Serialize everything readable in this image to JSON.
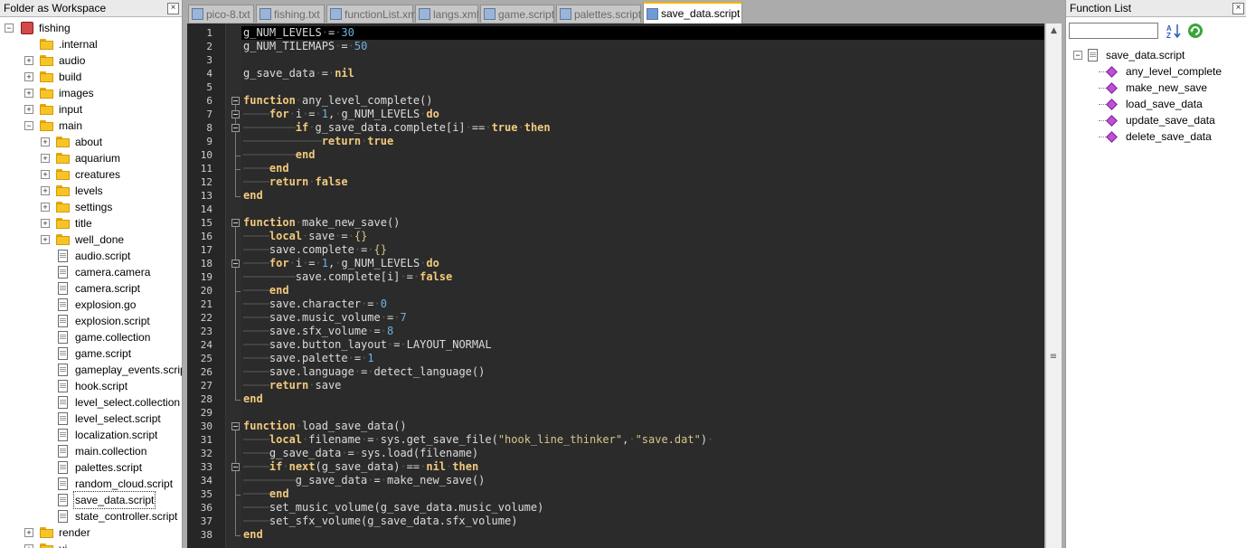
{
  "workspace": {
    "title": "Folder as Workspace",
    "close": "×",
    "tree": [
      {
        "label": "fishing",
        "depth": 0,
        "type": "root",
        "exp": "−"
      },
      {
        "label": ".internal",
        "depth": 1,
        "type": "folder",
        "exp": ""
      },
      {
        "label": "audio",
        "depth": 1,
        "type": "folder",
        "exp": "+"
      },
      {
        "label": "build",
        "depth": 1,
        "type": "folder",
        "exp": "+"
      },
      {
        "label": "images",
        "depth": 1,
        "type": "folder",
        "exp": "+"
      },
      {
        "label": "input",
        "depth": 1,
        "type": "folder",
        "exp": "+"
      },
      {
        "label": "main",
        "depth": 1,
        "type": "folder",
        "exp": "−"
      },
      {
        "label": "about",
        "depth": 2,
        "type": "folder",
        "exp": "+"
      },
      {
        "label": "aquarium",
        "depth": 2,
        "type": "folder",
        "exp": "+"
      },
      {
        "label": "creatures",
        "depth": 2,
        "type": "folder",
        "exp": "+"
      },
      {
        "label": "levels",
        "depth": 2,
        "type": "folder",
        "exp": "+"
      },
      {
        "label": "settings",
        "depth": 2,
        "type": "folder",
        "exp": "+"
      },
      {
        "label": "title",
        "depth": 2,
        "type": "folder",
        "exp": "+"
      },
      {
        "label": "well_done",
        "depth": 2,
        "type": "folder",
        "exp": "+"
      },
      {
        "label": "audio.script",
        "depth": 2,
        "type": "file",
        "exp": ""
      },
      {
        "label": "camera.camera",
        "depth": 2,
        "type": "file",
        "exp": ""
      },
      {
        "label": "camera.script",
        "depth": 2,
        "type": "file",
        "exp": ""
      },
      {
        "label": "explosion.go",
        "depth": 2,
        "type": "file",
        "exp": ""
      },
      {
        "label": "explosion.script",
        "depth": 2,
        "type": "file",
        "exp": ""
      },
      {
        "label": "game.collection",
        "depth": 2,
        "type": "file",
        "exp": ""
      },
      {
        "label": "game.script",
        "depth": 2,
        "type": "file",
        "exp": ""
      },
      {
        "label": "gameplay_events.script",
        "depth": 2,
        "type": "file",
        "exp": ""
      },
      {
        "label": "hook.script",
        "depth": 2,
        "type": "file",
        "exp": ""
      },
      {
        "label": "level_select.collection",
        "depth": 2,
        "type": "file",
        "exp": ""
      },
      {
        "label": "level_select.script",
        "depth": 2,
        "type": "file",
        "exp": ""
      },
      {
        "label": "localization.script",
        "depth": 2,
        "type": "file",
        "exp": ""
      },
      {
        "label": "main.collection",
        "depth": 2,
        "type": "file",
        "exp": ""
      },
      {
        "label": "palettes.script",
        "depth": 2,
        "type": "file",
        "exp": ""
      },
      {
        "label": "random_cloud.script",
        "depth": 2,
        "type": "file",
        "exp": ""
      },
      {
        "label": "save_data.script",
        "depth": 2,
        "type": "file",
        "exp": "",
        "selected": true
      },
      {
        "label": "state_controller.script",
        "depth": 2,
        "type": "file",
        "exp": ""
      },
      {
        "label": "render",
        "depth": 1,
        "type": "folder",
        "exp": "+"
      },
      {
        "label": "ui",
        "depth": 1,
        "type": "folder",
        "exp": "+"
      }
    ]
  },
  "tabs": [
    {
      "label": "pico-8.txt",
      "active": false
    },
    {
      "label": "fishing.txt",
      "active": false
    },
    {
      "label": "functionList.xml",
      "active": false
    },
    {
      "label": "langs.xml",
      "active": false
    },
    {
      "label": "game.script",
      "active": false
    },
    {
      "label": "palettes.script",
      "active": false
    },
    {
      "label": "save_data.script",
      "active": true
    }
  ],
  "editor": {
    "lines": [
      {
        "n": "1",
        "t": [
          [
            "var",
            "g_NUM_LEVELS"
          ],
          [
            "ws",
            "·"
          ],
          [
            "op",
            "="
          ],
          [
            "ws",
            "·"
          ],
          [
            "num",
            "30"
          ]
        ]
      },
      {
        "n": "2",
        "t": [
          [
            "var",
            "g_NUM_TILEMAPS"
          ],
          [
            "ws",
            "·"
          ],
          [
            "op",
            "="
          ],
          [
            "ws",
            "·"
          ],
          [
            "num",
            "50"
          ]
        ]
      },
      {
        "n": "3",
        "t": []
      },
      {
        "n": "4",
        "t": [
          [
            "var",
            "g_save_data"
          ],
          [
            "ws",
            "·"
          ],
          [
            "op",
            "="
          ],
          [
            "ws",
            "·"
          ],
          [
            "kw",
            "nil"
          ]
        ]
      },
      {
        "n": "5",
        "t": []
      },
      {
        "n": "6",
        "t": [
          [
            "kw",
            "function"
          ],
          [
            "ws",
            "·"
          ],
          [
            "var",
            "any_level_complete()"
          ]
        ]
      },
      {
        "n": "7",
        "t": [
          [
            "ws",
            "────"
          ],
          [
            "kw",
            "for"
          ],
          [
            "ws",
            "·"
          ],
          [
            "var",
            "i"
          ],
          [
            "ws",
            "·"
          ],
          [
            "op",
            "="
          ],
          [
            "ws",
            "·"
          ],
          [
            "num",
            "1"
          ],
          [
            "op",
            ","
          ],
          [
            "ws",
            "·"
          ],
          [
            "var",
            "g_NUM_LEVELS"
          ],
          [
            "ws",
            "·"
          ],
          [
            "kw",
            "do"
          ]
        ]
      },
      {
        "n": "8",
        "t": [
          [
            "ws",
            "────────"
          ],
          [
            "kw",
            "if"
          ],
          [
            "ws",
            "·"
          ],
          [
            "var",
            "g_save_data.complete[i]"
          ],
          [
            "ws",
            "·"
          ],
          [
            "op",
            "=="
          ],
          [
            "ws",
            "·"
          ],
          [
            "kw",
            "true"
          ],
          [
            "ws",
            "·"
          ],
          [
            "kw",
            "then"
          ]
        ]
      },
      {
        "n": "9",
        "t": [
          [
            "ws",
            "────────────"
          ],
          [
            "kw",
            "return"
          ],
          [
            "ws",
            "·"
          ],
          [
            "kw",
            "true"
          ]
        ]
      },
      {
        "n": "10",
        "t": [
          [
            "ws",
            "────────"
          ],
          [
            "kw",
            "end"
          ]
        ]
      },
      {
        "n": "11",
        "t": [
          [
            "ws",
            "────"
          ],
          [
            "kw",
            "end"
          ]
        ]
      },
      {
        "n": "12",
        "t": [
          [
            "ws",
            "────"
          ],
          [
            "kw",
            "return"
          ],
          [
            "ws",
            "·"
          ],
          [
            "kw",
            "false"
          ]
        ]
      },
      {
        "n": "13",
        "t": [
          [
            "kw",
            "end"
          ]
        ]
      },
      {
        "n": "14",
        "t": []
      },
      {
        "n": "15",
        "t": [
          [
            "kw",
            "function"
          ],
          [
            "ws",
            "·"
          ],
          [
            "var",
            "make_new_save()"
          ]
        ]
      },
      {
        "n": "16",
        "t": [
          [
            "ws",
            "────"
          ],
          [
            "kw",
            "local"
          ],
          [
            "ws",
            "·"
          ],
          [
            "var",
            "save"
          ],
          [
            "ws",
            "·"
          ],
          [
            "op",
            "="
          ],
          [
            "ws",
            "·"
          ],
          [
            "str",
            "{}"
          ]
        ]
      },
      {
        "n": "17",
        "t": [
          [
            "ws",
            "────"
          ],
          [
            "var",
            "save.complete"
          ],
          [
            "ws",
            "·"
          ],
          [
            "op",
            "="
          ],
          [
            "ws",
            "·"
          ],
          [
            "str",
            "{}"
          ]
        ]
      },
      {
        "n": "18",
        "t": [
          [
            "ws",
            "────"
          ],
          [
            "kw",
            "for"
          ],
          [
            "ws",
            "·"
          ],
          [
            "var",
            "i"
          ],
          [
            "ws",
            "·"
          ],
          [
            "op",
            "="
          ],
          [
            "ws",
            "·"
          ],
          [
            "num",
            "1"
          ],
          [
            "op",
            ","
          ],
          [
            "ws",
            "·"
          ],
          [
            "var",
            "g_NUM_LEVELS"
          ],
          [
            "ws",
            "·"
          ],
          [
            "kw",
            "do"
          ]
        ]
      },
      {
        "n": "19",
        "t": [
          [
            "ws",
            "────────"
          ],
          [
            "var",
            "save.complete[i]"
          ],
          [
            "ws",
            "·"
          ],
          [
            "op",
            "="
          ],
          [
            "ws",
            "·"
          ],
          [
            "kw",
            "false"
          ]
        ]
      },
      {
        "n": "20",
        "t": [
          [
            "ws",
            "────"
          ],
          [
            "kw",
            "end"
          ]
        ]
      },
      {
        "n": "21",
        "t": [
          [
            "ws",
            "────"
          ],
          [
            "var",
            "save.character"
          ],
          [
            "ws",
            "·"
          ],
          [
            "op",
            "="
          ],
          [
            "ws",
            "·"
          ],
          [
            "num",
            "0"
          ]
        ]
      },
      {
        "n": "22",
        "t": [
          [
            "ws",
            "────"
          ],
          [
            "var",
            "save.music_volume"
          ],
          [
            "ws",
            "·"
          ],
          [
            "op",
            "="
          ],
          [
            "ws",
            "·"
          ],
          [
            "num",
            "7"
          ]
        ]
      },
      {
        "n": "23",
        "t": [
          [
            "ws",
            "────"
          ],
          [
            "var",
            "save.sfx_volume"
          ],
          [
            "ws",
            "·"
          ],
          [
            "op",
            "="
          ],
          [
            "ws",
            "·"
          ],
          [
            "num",
            "8"
          ]
        ]
      },
      {
        "n": "24",
        "t": [
          [
            "ws",
            "────"
          ],
          [
            "var",
            "save.button_layout"
          ],
          [
            "ws",
            "·"
          ],
          [
            "op",
            "="
          ],
          [
            "ws",
            "·"
          ],
          [
            "var",
            "LAYOUT_NORMAL"
          ]
        ]
      },
      {
        "n": "25",
        "t": [
          [
            "ws",
            "────"
          ],
          [
            "var",
            "save.palette"
          ],
          [
            "ws",
            "·"
          ],
          [
            "op",
            "="
          ],
          [
            "ws",
            "·"
          ],
          [
            "num",
            "1"
          ]
        ]
      },
      {
        "n": "26",
        "t": [
          [
            "ws",
            "────"
          ],
          [
            "var",
            "save.language"
          ],
          [
            "ws",
            "·"
          ],
          [
            "op",
            "="
          ],
          [
            "ws",
            "·"
          ],
          [
            "var",
            "detect_language()"
          ]
        ]
      },
      {
        "n": "27",
        "t": [
          [
            "ws",
            "────"
          ],
          [
            "kw",
            "return"
          ],
          [
            "ws",
            "·"
          ],
          [
            "var",
            "save"
          ]
        ]
      },
      {
        "n": "28",
        "t": [
          [
            "kw",
            "end"
          ]
        ]
      },
      {
        "n": "29",
        "t": []
      },
      {
        "n": "30",
        "t": [
          [
            "kw",
            "function"
          ],
          [
            "ws",
            "·"
          ],
          [
            "var",
            "load_save_data()"
          ]
        ]
      },
      {
        "n": "31",
        "t": [
          [
            "ws",
            "────"
          ],
          [
            "kw",
            "local"
          ],
          [
            "ws",
            "·"
          ],
          [
            "var",
            "filename"
          ],
          [
            "ws",
            "·"
          ],
          [
            "op",
            "="
          ],
          [
            "ws",
            "·"
          ],
          [
            "var",
            "sys.get_save_file("
          ],
          [
            "str",
            "\"hook_line_thinker\""
          ],
          [
            "op",
            ","
          ],
          [
            "ws",
            "·"
          ],
          [
            "str",
            "\"save.dat\""
          ],
          [
            "var",
            ")"
          ],
          [
            "ws",
            "·"
          ]
        ]
      },
      {
        "n": "32",
        "t": [
          [
            "ws",
            "────"
          ],
          [
            "var",
            "g_save_data"
          ],
          [
            "ws",
            "·"
          ],
          [
            "op",
            "="
          ],
          [
            "ws",
            "·"
          ],
          [
            "var",
            "sys.load(filename)"
          ]
        ]
      },
      {
        "n": "33",
        "t": [
          [
            "ws",
            "────"
          ],
          [
            "kw",
            "if"
          ],
          [
            "ws",
            "·"
          ],
          [
            "kw",
            "next"
          ],
          [
            "var",
            "(g_save_data)"
          ],
          [
            "ws",
            "·"
          ],
          [
            "op",
            "=="
          ],
          [
            "ws",
            "·"
          ],
          [
            "kw",
            "nil"
          ],
          [
            "ws",
            "·"
          ],
          [
            "kw",
            "then"
          ]
        ]
      },
      {
        "n": "34",
        "t": [
          [
            "ws",
            "────────"
          ],
          [
            "var",
            "g_save_data"
          ],
          [
            "ws",
            "·"
          ],
          [
            "op",
            "="
          ],
          [
            "ws",
            "·"
          ],
          [
            "var",
            "make_new_save()"
          ]
        ]
      },
      {
        "n": "35",
        "t": [
          [
            "ws",
            "────"
          ],
          [
            "kw",
            "end"
          ]
        ]
      },
      {
        "n": "36",
        "t": [
          [
            "ws",
            "────"
          ],
          [
            "var",
            "set_music_volume(g_save_data.music_volume)"
          ]
        ]
      },
      {
        "n": "37",
        "t": [
          [
            "ws",
            "────"
          ],
          [
            "var",
            "set_sfx_volume(g_save_data.sfx_volume)"
          ]
        ]
      },
      {
        "n": "38",
        "t": [
          [
            "kw",
            "end"
          ]
        ]
      }
    ]
  },
  "function_list": {
    "title": "Function List",
    "close": "×",
    "search_value": "",
    "file": "save_data.script",
    "functions": [
      "any_level_complete",
      "make_new_save",
      "load_save_data",
      "update_save_data",
      "delete_save_data"
    ],
    "sort_icon": "sort-az-icon",
    "refresh_icon": "refresh-icon",
    "accent_color": "#f2b400"
  }
}
